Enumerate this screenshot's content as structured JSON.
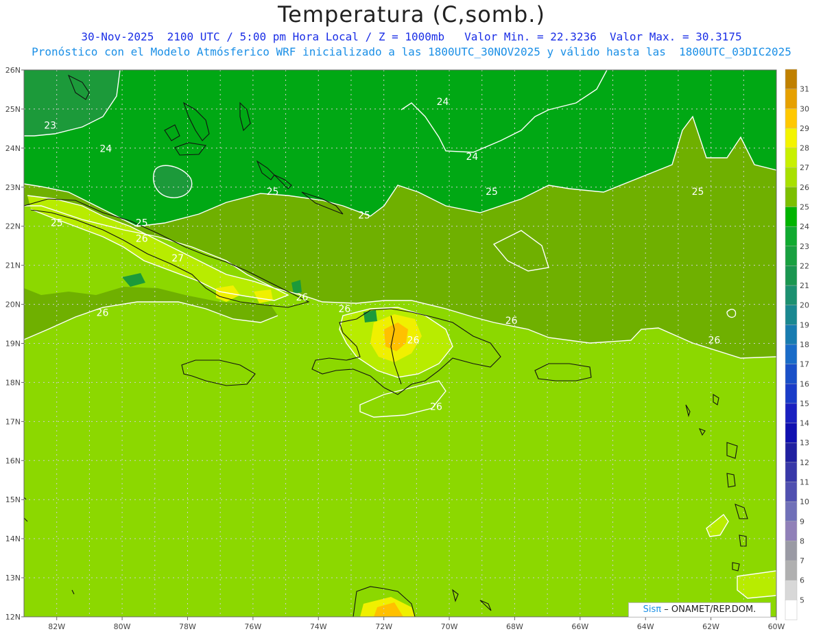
{
  "header": {
    "title": "Temperatura (C,somb.)",
    "subtitle_line1": "30-Nov-2025  2100 UTC / 5:00 pm Hora Local / Z = 1000mb   Valor Min. = 22.3236  Valor Max. = 30.3175",
    "subtitle_line2": "Pronóstico con el Modelo Atmósferico WRF inicializado a las 1800UTC_30NOV2025 y válido hasta las  1800UTC_03DIC2025"
  },
  "map": {
    "lon_range": [
      -83,
      -60
    ],
    "lat_range": [
      12,
      26
    ],
    "lat_labels": [
      "26N",
      "25N",
      "24N",
      "23N",
      "22N",
      "21N",
      "20N",
      "19N",
      "18N",
      "17N",
      "16N",
      "15N",
      "14N",
      "13N",
      "12N"
    ],
    "lon_labels": [
      "82W",
      "80W",
      "78W",
      "76W",
      "74W",
      "72W",
      "70W",
      "68W",
      "66W",
      "64W",
      "62W",
      "60W"
    ],
    "contour_labels": [
      {
        "text": "23",
        "lon": -82.2,
        "lat": 24.5
      },
      {
        "text": "24",
        "lon": -80.5,
        "lat": 23.9
      },
      {
        "text": "24",
        "lon": -70.2,
        "lat": 25.1
      },
      {
        "text": "24",
        "lon": -69.3,
        "lat": 23.7
      },
      {
        "text": "25",
        "lon": -75.4,
        "lat": 22.8
      },
      {
        "text": "25",
        "lon": -82.0,
        "lat": 22.0
      },
      {
        "text": "25",
        "lon": -72.6,
        "lat": 22.2
      },
      {
        "text": "25",
        "lon": -68.7,
        "lat": 22.8
      },
      {
        "text": "25",
        "lon": -62.4,
        "lat": 22.8
      },
      {
        "text": "25",
        "lon": -79.4,
        "lat": 22.0
      },
      {
        "text": "26",
        "lon": -79.4,
        "lat": 21.6
      },
      {
        "text": "26",
        "lon": -80.6,
        "lat": 19.7
      },
      {
        "text": "26",
        "lon": -74.5,
        "lat": 20.1
      },
      {
        "text": "26",
        "lon": -73.2,
        "lat": 19.8
      },
      {
        "text": "26",
        "lon": -71.1,
        "lat": 19.0
      },
      {
        "text": "26",
        "lon": -70.4,
        "lat": 17.3
      },
      {
        "text": "26",
        "lon": -68.1,
        "lat": 19.5
      },
      {
        "text": "26",
        "lon": -61.9,
        "lat": 19.0
      },
      {
        "text": "27",
        "lon": -78.3,
        "lat": 21.1
      }
    ]
  },
  "colorbar": {
    "levels": [
      "31",
      "30",
      "29",
      "28",
      "27",
      "26",
      "25",
      "24",
      "23",
      "22",
      "21",
      "20",
      "19",
      "18",
      "17",
      "16",
      "15",
      "14",
      "13",
      "12",
      "11",
      "10",
      "9",
      "8",
      "7",
      "6",
      "5"
    ],
    "colors": [
      "#c08000",
      "#e6a000",
      "#ffc800",
      "#f4f400",
      "#c8f000",
      "#a8e000",
      "#7cbf00",
      "#00b400",
      "#10aa30",
      "#18a040",
      "#1a9650",
      "#1c9070",
      "#1a8890",
      "#187cb0",
      "#1a6cc8",
      "#1a50c8",
      "#1a3cc8",
      "#1a20c0",
      "#1010b0",
      "#2020a0",
      "#3838a8",
      "#5050b0",
      "#7070b8",
      "#9080b8",
      "#9a9aa4",
      "#b0b0b0",
      "#d8d8d8",
      "#ffffff"
    ]
  },
  "credit": {
    "brand": "Sisπ",
    "text": "– ONAMET/REP.DOM."
  }
}
